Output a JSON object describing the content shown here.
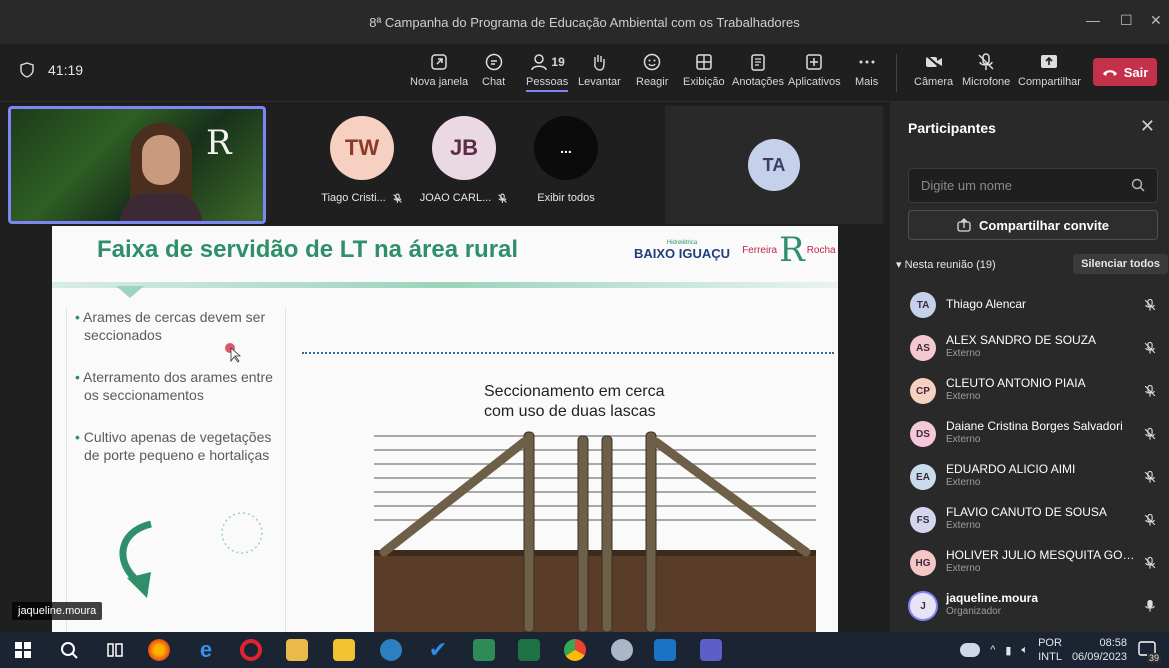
{
  "window": {
    "title": "8ª Campanha do Programa de Educação Ambiental com os Trabalhadores"
  },
  "meeting": {
    "timer": "41:19"
  },
  "toolbar": {
    "items": [
      {
        "label": "Nova janela",
        "icon": "new-window-icon"
      },
      {
        "label": "Chat",
        "icon": "chat-icon"
      },
      {
        "label": "Pessoas",
        "icon": "people-icon",
        "badge": "19"
      },
      {
        "label": "Levantar",
        "icon": "raise-hand-icon"
      },
      {
        "label": "Reagir",
        "icon": "react-icon"
      },
      {
        "label": "Exibição",
        "icon": "view-icon"
      },
      {
        "label": "Anotações",
        "icon": "notes-icon"
      },
      {
        "label": "Aplicativos",
        "icon": "apps-icon"
      },
      {
        "label": "Mais",
        "icon": "more-icon"
      },
      {
        "label": "Câmera",
        "icon": "camera-off-icon"
      },
      {
        "label": "Microfone",
        "icon": "mic-off-icon"
      },
      {
        "label": "Compartilhar",
        "icon": "share-icon"
      }
    ],
    "leave": "Sair"
  },
  "stage": {
    "tiles": [
      {
        "initials": "TW",
        "label": "Tiago Cristi..."
      },
      {
        "initials": "JB",
        "label": "JOAO CARL..."
      },
      {
        "initials": "...",
        "label": "Exibir todos"
      }
    ],
    "speaker_initials": "TA",
    "self_name": "jaqueline.moura"
  },
  "slide": {
    "title": "Faixa de servidão de LT na área rural",
    "bullets": [
      "Arames de cercas devem ser seccionados",
      "Aterramento dos arames entre os seccionamentos",
      "Cultivo apenas de vegetações de porte pequeno e hortaliças"
    ],
    "caption_line1": "Seccionamento em cerca",
    "caption_line2": "com uso de duas lascas",
    "logo1_small": "Hidrelétrica",
    "logo1_big": "BAIXO IGUAÇU",
    "logo2_left": "Ferreira",
    "logo2_letter": "R",
    "logo2_right": "Rocha"
  },
  "panel": {
    "title": "Participantes",
    "search_placeholder": "Digite um nome",
    "invite": "Compartilhar convite",
    "section": "Nesta reunião (19)",
    "mute_all": "Silenciar todos",
    "participants": [
      {
        "initials": "TA",
        "name": "Thiago Alencar",
        "role": "",
        "color": "#c5d1ea"
      },
      {
        "initials": "AS",
        "name": "ALEX SANDRO DE SOUZA",
        "role": "Externo",
        "color": "#f4c8cf"
      },
      {
        "initials": "CP",
        "name": "CLEUTO ANTONIO PIAIA",
        "role": "Externo",
        "color": "#f6d0c0"
      },
      {
        "initials": "DS",
        "name": "Daiane Cristina Borges Salvadori",
        "role": "Externo",
        "color": "#f4c8d9"
      },
      {
        "initials": "EA",
        "name": "EDUARDO ALICIO AIMI",
        "role": "Externo",
        "color": "#c8dcee"
      },
      {
        "initials": "FS",
        "name": "FLAVIO CANUTO DE SOUSA",
        "role": "Externo",
        "color": "#d4d6f0"
      },
      {
        "initials": "HG",
        "name": "HOLIVER JULIO MESQUITA GON...",
        "role": "Externo",
        "color": "#f6c6c6"
      },
      {
        "initials": "J",
        "name": "jaqueline.moura",
        "role": "Organizador",
        "color": "#e8e4f6"
      }
    ]
  },
  "taskbar": {
    "lang1": "POR",
    "lang2": "INTL",
    "time": "08:58",
    "date": "06/09/2023",
    "notifications": "39"
  },
  "colors": {
    "accent": "#7f85f5",
    "leave": "#c4314b",
    "slide_green": "#2f8f6a"
  }
}
